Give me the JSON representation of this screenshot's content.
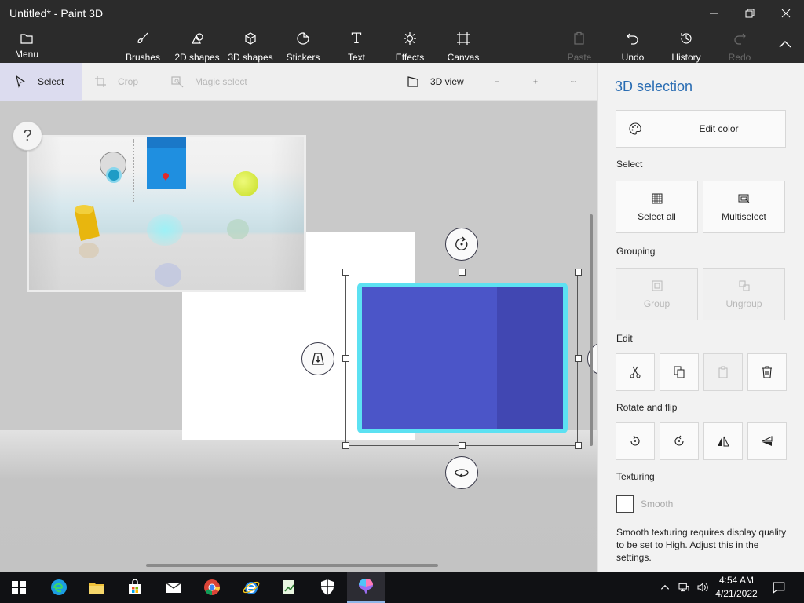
{
  "window": {
    "title": "Untitled* - Paint 3D"
  },
  "ribbon": {
    "menu": "Menu",
    "brushes": "Brushes",
    "shapes2d": "2D shapes",
    "shapes3d": "3D shapes",
    "stickers": "Stickers",
    "text": "Text",
    "effects": "Effects",
    "canvas": "Canvas",
    "paste": "Paste",
    "undo": "Undo",
    "history": "History",
    "redo": "Redo"
  },
  "toolbar": {
    "select": "Select",
    "crop": "Crop",
    "magic_select": "Magic select",
    "view3d": "3D view"
  },
  "canvas": {
    "help": "?"
  },
  "panel": {
    "title": "3D selection",
    "edit_color": "Edit color",
    "select_header": "Select",
    "select_all": "Select all",
    "multiselect": "Multiselect",
    "grouping_header": "Grouping",
    "group": "Group",
    "ungroup": "Ungroup",
    "edit_header": "Edit",
    "rotate_header": "Rotate and flip",
    "texturing_header": "Texturing",
    "smooth": "Smooth",
    "note": "Smooth texturing requires display quality to be set to High. Adjust this in the settings."
  },
  "taskbar": {
    "time": "4:54 AM",
    "date": "4/21/2022"
  },
  "colors": {
    "accent": "#2a6db3",
    "cube": "#4a52c8",
    "outline": "#5ce1f2",
    "ribbon": "#2b2b2b"
  }
}
